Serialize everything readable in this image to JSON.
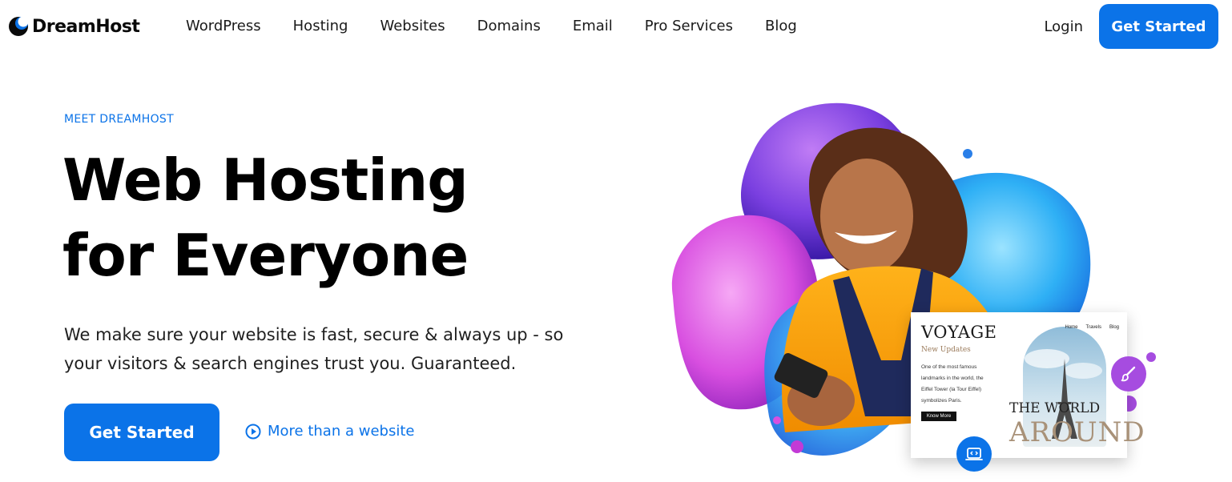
{
  "brand": {
    "name": "DreamHost",
    "primary_color": "#0b73e8",
    "accent_purple": "#a64ce0"
  },
  "nav": {
    "items": [
      {
        "label": "WordPress"
      },
      {
        "label": "Hosting"
      },
      {
        "label": "Websites"
      },
      {
        "label": "Domains"
      },
      {
        "label": "Email"
      },
      {
        "label": "Pro Services"
      },
      {
        "label": "Blog"
      }
    ],
    "login_label": "Login",
    "cta_label": "Get Started"
  },
  "hero": {
    "eyebrow": "MEET DREAMHOST",
    "headline_line1": "Web Hosting",
    "headline_line2": "for Everyone",
    "subcopy": "We make sure your website is fast, secure & always up - so your visitors & search engines trust you. Guaranteed.",
    "cta_label": "Get Started",
    "secondary_link": "More than a website",
    "secondary_icon": "play-circle-icon"
  },
  "site_preview": {
    "title": "VOYAGE",
    "subtitle": "New Updates",
    "body": "One of the most famous landmarks in the world, the Eiffel Tower (la Tour Eiffel) symbolizes Paris.",
    "button": "Know More",
    "nav": [
      "Home",
      "Travels",
      "Blog"
    ],
    "headline_top": "THE WORLD",
    "headline_bottom": "AROUND"
  },
  "floating_icons": {
    "brush": "paintbrush-icon",
    "code": "code-icon"
  }
}
